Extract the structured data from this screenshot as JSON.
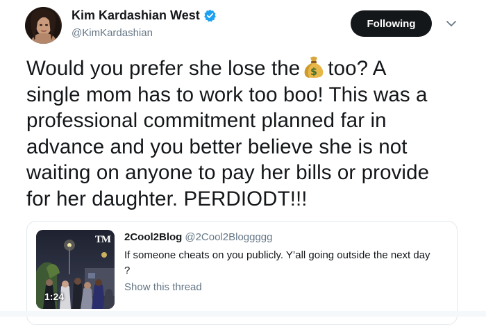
{
  "author": {
    "name": "Kim Kardashian West",
    "handle": "@KimKardashian",
    "verified": true
  },
  "follow_button": {
    "label": "Following"
  },
  "icons": {
    "verified": "verified-badge-icon",
    "menu": "chevron-down-icon",
    "emoji": "money-bag-emoji"
  },
  "tweet": {
    "line1_before": "Would you prefer she lose the",
    "line1_after": "too? A",
    "line2": "single mom has to work too boo! This was a",
    "line3": "professional commitment planned far in",
    "line4": "advance and you better believe she is not",
    "line5": "waiting on anyone to pay her bills or provide",
    "line6": "for her daughter. PERDIODT!!!"
  },
  "quoted_tweet": {
    "name": "2Cool2Blog",
    "handle": "@2Cool2Bloggggg",
    "text_line1": "If someone cheats on you publicly. Y’all going outside the next day",
    "text_line2": "?",
    "thread_link": "Show this thread",
    "video_duration": "1:24",
    "thumb_logo": "TM"
  },
  "colors": {
    "verified_blue": "#1da1f2",
    "text_dark": "#14171a",
    "text_muted": "#657786",
    "border": "#e1e8ed"
  }
}
